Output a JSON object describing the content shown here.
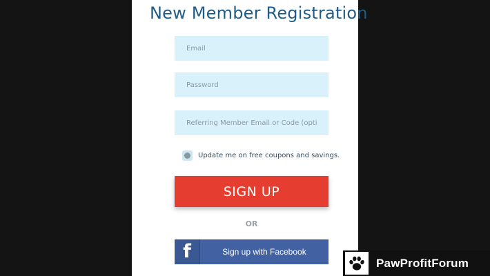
{
  "form": {
    "title": "New Member Registration",
    "email_placeholder": "Email",
    "password_placeholder": "Password",
    "referral_placeholder": "Referring Member Email or Code (optional)",
    "newsletter_label": "Update me on free coupons and savings.",
    "signup_label": "SIGN UP",
    "or_text": "OR",
    "facebook_letter": "f",
    "facebook_label": "Sign up with Facebook"
  },
  "watermark": {
    "brand_name": "PawProfitForum",
    "icon": "paw-icon"
  },
  "colors": {
    "title": "#1f5d87",
    "field_bg": "#d9f1fb",
    "signup_bg": "#e53d30",
    "facebook_bg": "#4161a3",
    "page_bg": "#141414"
  }
}
